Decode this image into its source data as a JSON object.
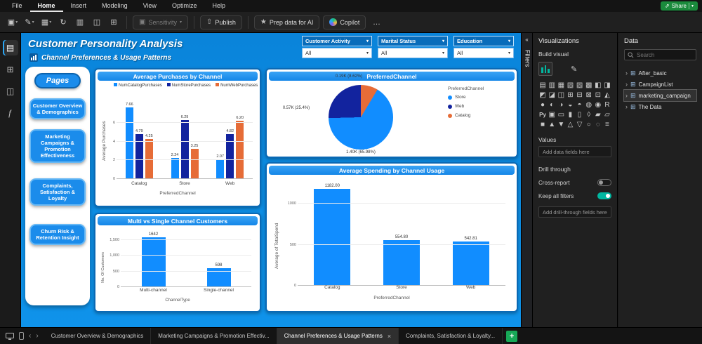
{
  "colors": {
    "accent": "#118DFF",
    "navy": "#12239E",
    "orange": "#E66C37",
    "canvas_blue": "#0D8CE4",
    "card_border": "#0A69B5",
    "share_green": "#1A8A3C",
    "toggle_on": "#00B7A0"
  },
  "menu": {
    "items": [
      "File",
      "Home",
      "Insert",
      "Modeling",
      "View",
      "Optimize",
      "Help"
    ],
    "active_item": "Home",
    "share_label": "Share"
  },
  "ribbon": {
    "tools": [
      {
        "name": "paste-tool-icon",
        "glyph": "▣",
        "caret": true
      },
      {
        "name": "format-painter-icon",
        "glyph": "✎",
        "caret": true
      },
      {
        "name": "theme-icon",
        "glyph": "▦",
        "caret": true
      },
      {
        "name": "refresh-icon",
        "glyph": "↻",
        "caret": false
      },
      {
        "name": "new-visual-icon",
        "glyph": "▥",
        "caret": false
      },
      {
        "name": "text-box-icon",
        "glyph": "◫",
        "caret": false
      },
      {
        "name": "quick-measure-icon",
        "glyph": "⊞",
        "caret": false
      }
    ],
    "sensitivity_label": "Sensitivity",
    "publish_label": "Publish",
    "prep_ai_label": "Prep data for AI",
    "copilot_label": "Copilot",
    "more_label": "…"
  },
  "left_rail": {
    "items": [
      {
        "name": "report-view-icon",
        "glyph": "▤",
        "active": true
      },
      {
        "name": "table-view-icon",
        "glyph": "⊞",
        "active": false
      },
      {
        "name": "model-view-icon",
        "glyph": "◫",
        "active": false
      },
      {
        "name": "dax-query-view-icon",
        "glyph": "ƒ",
        "active": false
      }
    ]
  },
  "report": {
    "title": "Customer Personality Analysis",
    "subtitle": "Channel Preferences & Usage Patterns",
    "slicers": [
      {
        "label": "Customer Activity",
        "value": "All"
      },
      {
        "label": "Marital Status",
        "value": "All"
      },
      {
        "label": "Education",
        "value": "All"
      }
    ],
    "pages": {
      "title": "Pages",
      "buttons": [
        "Customer Overview & Demographics",
        "Marketing Campaigns & Promotion Effectiveness",
        "Complaints, Satisfaction & Loyalty",
        "Churn Risk & Retention Insight"
      ]
    }
  },
  "chart_data": [
    {
      "type": "bar",
      "variant": "clustered-column",
      "title": "Average Purchases by Channel",
      "categories": [
        "Catalog",
        "Store",
        "Web"
      ],
      "series": [
        {
          "name": "NumCatalogPurchases",
          "color": "#118DFF",
          "values": [
            7.66,
            2.24,
            2.07
          ],
          "labels": [
            "7.66",
            "2.24",
            "2.07"
          ]
        },
        {
          "name": "NumStorePurchases",
          "color": "#12239E",
          "values": [
            4.79,
            6.29,
            4.82
          ],
          "labels": [
            "4.79",
            "6.29",
            "4.82"
          ]
        },
        {
          "name": "NumWebPurchases",
          "color": "#E66C37",
          "values": [
            4.25,
            3.25,
            6.2
          ],
          "labels": [
            "4.25",
            "3.25",
            "6.20"
          ]
        }
      ],
      "xlabel": "PreferredChannel",
      "ylabel": "Average Purchases",
      "ylim": [
        0,
        8.4
      ],
      "yticks": [
        {
          "v": 0,
          "label": "0"
        },
        {
          "v": 2,
          "label": "2"
        },
        {
          "v": 4,
          "label": "4"
        },
        {
          "v": 6,
          "label": "6"
        }
      ],
      "grid": true,
      "legend_position": "top"
    },
    {
      "type": "pie",
      "title": "PreferredChannel",
      "legend_title": "PreferredChannel",
      "rotation_deg": 31,
      "slices": [
        {
          "label": "Store",
          "color": "#118DFF",
          "pct": 65.98,
          "callout": "1.40K (65.98%)"
        },
        {
          "label": "Web",
          "color": "#12239E",
          "pct": 25.4,
          "callout": "0.57K (25.4%)"
        },
        {
          "label": "Catalog",
          "color": "#E66C37",
          "pct": 8.62,
          "callout": "0.19K (8.62%)"
        }
      ],
      "legend_position": "right"
    },
    {
      "type": "bar",
      "variant": "column",
      "title": "Multi vs Single Channel Customers",
      "categories": [
        "Multi-channel",
        "Single-channel"
      ],
      "values": [
        1642,
        598
      ],
      "labels": [
        "1642",
        "598"
      ],
      "bar_color": "#118DFF",
      "xlabel": "ChannelType",
      "ylabel": "No. Of Customers",
      "ylim": [
        0,
        1750
      ],
      "yticks": [
        {
          "v": 0,
          "label": "0"
        },
        {
          "v": 500,
          "label": "500"
        },
        {
          "v": 1000,
          "label": "1,000"
        },
        {
          "v": 1500,
          "label": "1,500"
        }
      ],
      "grid": true
    },
    {
      "type": "bar",
      "variant": "column",
      "title": "Average Spending by Channel Usage",
      "categories": [
        "Catalog",
        "Store",
        "Web"
      ],
      "values": [
        1182.0,
        554.8,
        542.81
      ],
      "labels": [
        "1182.00",
        "554.80",
        "542.81"
      ],
      "bar_color": "#118DFF",
      "xlabel": "PreferredChannel",
      "ylabel": "Average of TotalSpend",
      "ylim": [
        0,
        1250
      ],
      "yticks": [
        {
          "v": 0,
          "label": "0"
        },
        {
          "v": 500,
          "label": "500"
        },
        {
          "v": 1000,
          "label": "1000"
        }
      ],
      "grid": true
    }
  ],
  "panes": {
    "filters_label": "Filters"
  },
  "viz_pane": {
    "title": "Visualizations",
    "build_visual": "Build visual",
    "values_label": "Values",
    "add_fields": "Add data fields here",
    "drill_through": "Drill through",
    "cross_report": "Cross-report",
    "cross_report_on": false,
    "keep_all_filters": "Keep all filters",
    "keep_all_filters_on": true,
    "add_drill_fields": "Add drill-through fields here",
    "icons": [
      {
        "name": "stacked-bar-chart-icon",
        "glyph": "▤"
      },
      {
        "name": "stacked-column-chart-icon",
        "glyph": "▥"
      },
      {
        "name": "clustered-bar-chart-icon",
        "glyph": "▦"
      },
      {
        "name": "clustered-column-chart-icon",
        "glyph": "▧"
      },
      {
        "name": "100-stacked-bar-icon",
        "glyph": "▨"
      },
      {
        "name": "100-stacked-column-icon",
        "glyph": "▩"
      },
      {
        "name": "line-chart-icon",
        "glyph": "◧"
      },
      {
        "name": "area-chart-icon",
        "glyph": "◨"
      },
      {
        "name": "stacked-area-icon",
        "glyph": "◩"
      },
      {
        "name": "line-stacked-column-icon",
        "glyph": "◪"
      },
      {
        "name": "line-clustered-column-icon",
        "glyph": "◫"
      },
      {
        "name": "ribbon-chart-icon",
        "glyph": "⊞"
      },
      {
        "name": "waterfall-icon",
        "glyph": "⊟"
      },
      {
        "name": "funnel-icon",
        "glyph": "⊠"
      },
      {
        "name": "scatter-icon",
        "glyph": "⊡"
      },
      {
        "name": "pie-icon",
        "glyph": "◭"
      },
      {
        "name": "donut-icon",
        "glyph": "●"
      },
      {
        "name": "treemap-icon",
        "glyph": "◐"
      },
      {
        "name": "map-icon",
        "glyph": "◑"
      },
      {
        "name": "filled-map-icon",
        "glyph": "◒"
      },
      {
        "name": "shape-map-icon",
        "glyph": "◓"
      },
      {
        "name": "azure-map-icon",
        "glyph": "◍"
      },
      {
        "name": "gauge-icon",
        "glyph": "◉"
      },
      {
        "name": "r-script-icon",
        "glyph": "R"
      },
      {
        "name": "python-icon",
        "glyph": "Py"
      },
      {
        "name": "card-icon",
        "glyph": "▣"
      },
      {
        "name": "multi-row-card-icon",
        "glyph": "▭"
      },
      {
        "name": "kpi-icon",
        "glyph": "▮"
      },
      {
        "name": "slicer-icon",
        "glyph": "▯"
      },
      {
        "name": "table-icon",
        "glyph": "◊"
      },
      {
        "name": "matrix-icon",
        "glyph": "▰"
      },
      {
        "name": "key-influencers-icon",
        "glyph": "▱"
      },
      {
        "name": "decomposition-tree-icon",
        "glyph": "■"
      },
      {
        "name": "qa-icon",
        "glyph": "▲"
      },
      {
        "name": "smart-narrative-icon",
        "glyph": "▼"
      },
      {
        "name": "metrics-icon",
        "glyph": "△"
      },
      {
        "name": "paginated-report-icon",
        "glyph": "▽"
      },
      {
        "name": "arcgis-icon",
        "glyph": "○"
      },
      {
        "name": "power-apps-icon",
        "glyph": "◌"
      },
      {
        "name": "more-visuals-icon",
        "glyph": "≡"
      }
    ]
  },
  "data_pane": {
    "title": "Data",
    "search_placeholder": "Search",
    "items": [
      {
        "label": "After_basic",
        "selected": false
      },
      {
        "label": "CampaignList",
        "selected": false
      },
      {
        "label": "marketing_campaign",
        "selected": true
      },
      {
        "label": "The Data",
        "selected": false
      }
    ]
  },
  "bottom_bar": {
    "tabs": [
      {
        "label": "Customer Overview & Demographics",
        "active": false
      },
      {
        "label": "Marketing Campaigns & Promotion Effectiv...",
        "active": false
      },
      {
        "label": "Channel Preferences & Usage Patterns",
        "active": true
      },
      {
        "label": "Complaints, Satisfaction & Loyalty...",
        "active": false
      }
    ],
    "new_page_label": "+"
  }
}
